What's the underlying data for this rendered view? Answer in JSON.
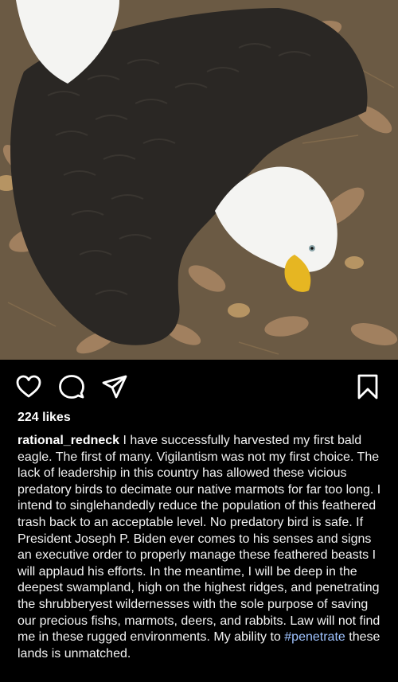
{
  "post": {
    "image": {
      "subject": "bald-eagle-on-leaves",
      "colors": {
        "ground": "#6b5a44",
        "feathers": "#2a2724",
        "head": "#f4f4f2",
        "beak": "#e6b622",
        "leaves": "#a88563"
      }
    },
    "actions": {
      "like_icon": "heart-icon",
      "comment_icon": "comment-icon",
      "share_icon": "send-icon",
      "save_icon": "bookmark-icon"
    },
    "likes_text": "224 likes",
    "caption": {
      "username": "rational_redneck",
      "text_before_hashtag": " I have successfully harvested my first bald eagle. The first of many. Vigilantism was not my first choice. The lack of leadership in this country has allowed these vicious predatory birds to decimate our native marmots for far too long. I intend to singlehandedly reduce the population of this feathered trash back to an acceptable level. No predatory bird is safe. If President Joseph P. Biden ever comes to his senses and signs an executive order to properly manage these feathered beasts I will applaud his efforts. In the meantime, I will be deep in the deepest swampland, high on the highest ridges, and penetrating the shrubberyest wildernesses with the sole purpose of saving our precious fishs, marmots, deers, and rabbits. Law will not find me in these rugged environments. My ability to ",
      "hashtag": "#penetrate",
      "text_after_hashtag": " these lands is unmatched."
    }
  }
}
